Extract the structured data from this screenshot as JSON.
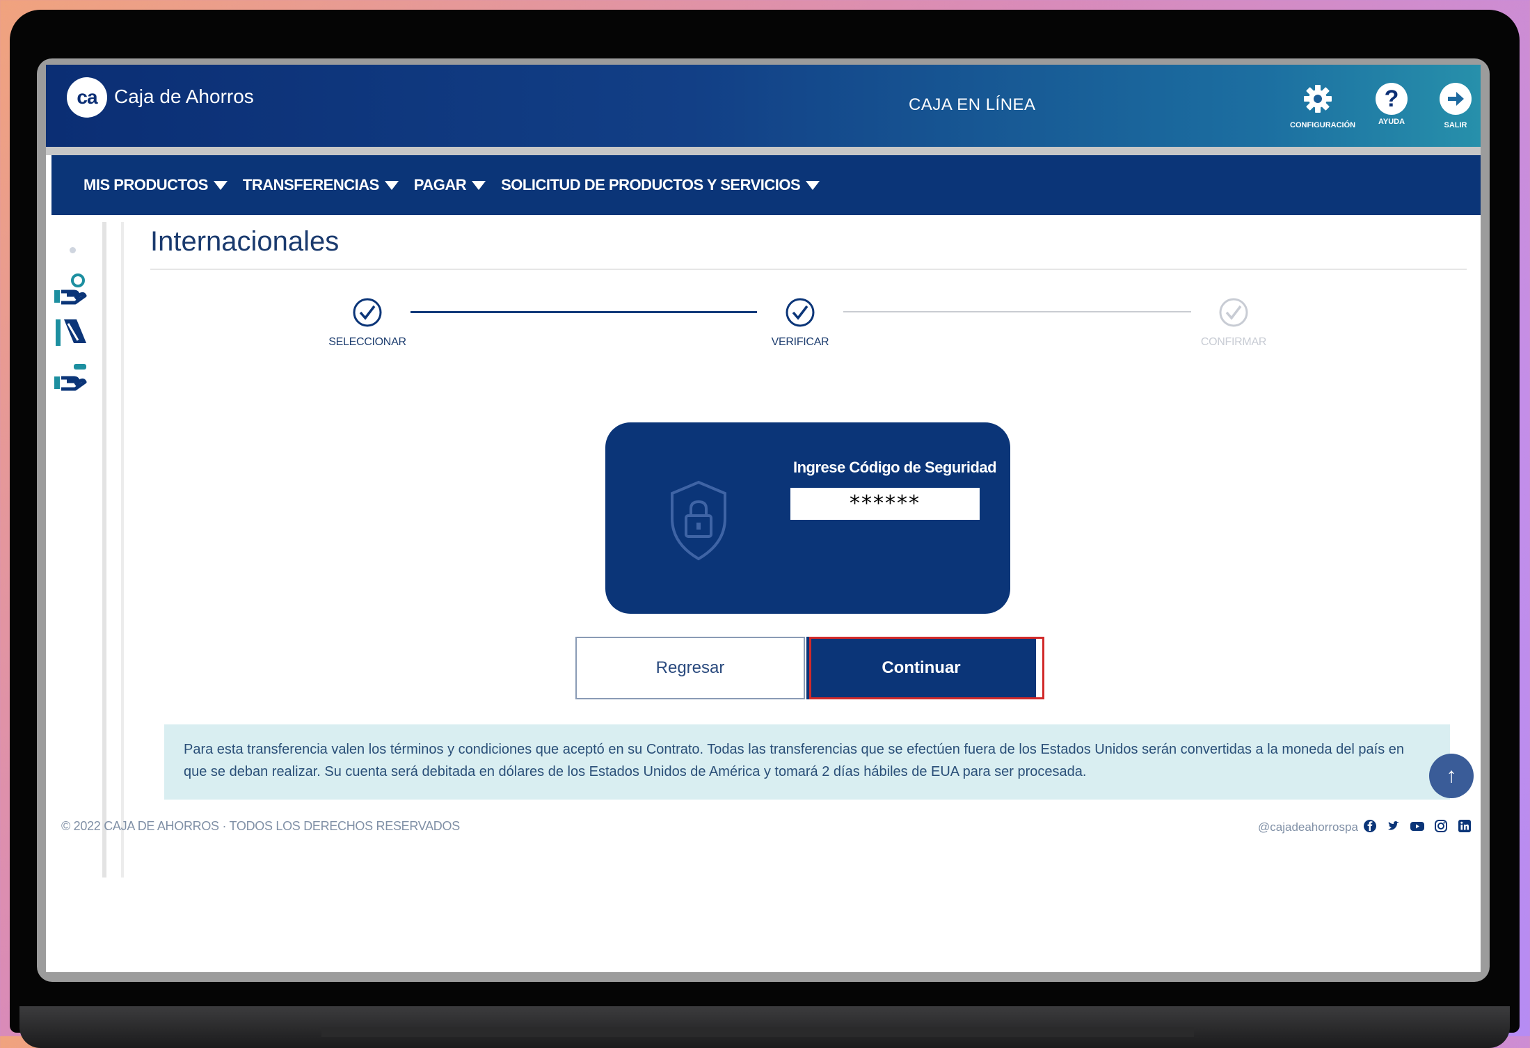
{
  "header": {
    "logo_mark": "ca",
    "brand": "Caja de Ahorros",
    "app_title": "CAJA EN LÍNEA",
    "buttons": [
      {
        "label": "CONFIGURACIÓN",
        "icon": "gear-icon"
      },
      {
        "label": "AYUDA",
        "icon": "help-icon"
      },
      {
        "label": "SALIR",
        "icon": "exit-icon"
      }
    ]
  },
  "nav": {
    "items": [
      "MIS PRODUCTOS",
      "TRANSFERENCIAS",
      "PAGAR",
      "SOLICITUD DE PRODUCTOS Y SERVICIOS"
    ]
  },
  "page": {
    "title": "Internacionales"
  },
  "steps": [
    {
      "label": "SELECCIONAR",
      "state": "done"
    },
    {
      "label": "VERIFICAR",
      "state": "done"
    },
    {
      "label": "CONFIRMAR",
      "state": "pending"
    }
  ],
  "security": {
    "label": "Ingrese Código de Seguridad",
    "value": "******"
  },
  "actions": {
    "back_label": "Regresar",
    "continue_label": "Continuar"
  },
  "notice": {
    "text": "Para esta transferencia valen los términos y condiciones que aceptó en su Contrato. Todas las transferencias que se efectúen fuera de los Estados Unidos serán convertidas a la moneda del país en que se deban realizar. Su cuenta será debitada en dólares de los Estados Unidos de América y tomará 2 días hábiles de EUA para ser procesada."
  },
  "footer": {
    "copyright": "© 2022 CAJA DE AHORROS · TODOS LOS DERECHOS RESERVADOS",
    "handle": "@cajadeahorrospa",
    "social": [
      "facebook-icon",
      "twitter-icon",
      "youtube-icon",
      "instagram-icon",
      "linkedin-icon"
    ]
  },
  "colors": {
    "primary": "#0b3578",
    "highlight": "#d12a2a",
    "notice_bg": "#d9eef1"
  }
}
